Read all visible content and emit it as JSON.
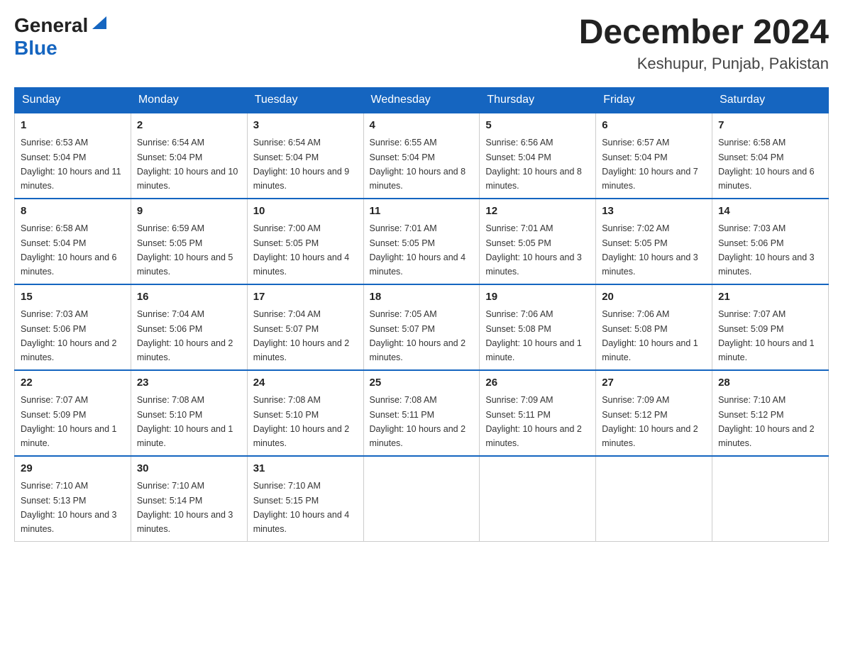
{
  "header": {
    "logo_general": "General",
    "logo_blue": "Blue",
    "month_title": "December 2024",
    "location": "Keshupur, Punjab, Pakistan"
  },
  "weekdays": [
    "Sunday",
    "Monday",
    "Tuesday",
    "Wednesday",
    "Thursday",
    "Friday",
    "Saturday"
  ],
  "weeks": [
    [
      {
        "day": "1",
        "sunrise": "6:53 AM",
        "sunset": "5:04 PM",
        "daylight": "10 hours and 11 minutes."
      },
      {
        "day": "2",
        "sunrise": "6:54 AM",
        "sunset": "5:04 PM",
        "daylight": "10 hours and 10 minutes."
      },
      {
        "day": "3",
        "sunrise": "6:54 AM",
        "sunset": "5:04 PM",
        "daylight": "10 hours and 9 minutes."
      },
      {
        "day": "4",
        "sunrise": "6:55 AM",
        "sunset": "5:04 PM",
        "daylight": "10 hours and 8 minutes."
      },
      {
        "day": "5",
        "sunrise": "6:56 AM",
        "sunset": "5:04 PM",
        "daylight": "10 hours and 8 minutes."
      },
      {
        "day": "6",
        "sunrise": "6:57 AM",
        "sunset": "5:04 PM",
        "daylight": "10 hours and 7 minutes."
      },
      {
        "day": "7",
        "sunrise": "6:58 AM",
        "sunset": "5:04 PM",
        "daylight": "10 hours and 6 minutes."
      }
    ],
    [
      {
        "day": "8",
        "sunrise": "6:58 AM",
        "sunset": "5:04 PM",
        "daylight": "10 hours and 6 minutes."
      },
      {
        "day": "9",
        "sunrise": "6:59 AM",
        "sunset": "5:05 PM",
        "daylight": "10 hours and 5 minutes."
      },
      {
        "day": "10",
        "sunrise": "7:00 AM",
        "sunset": "5:05 PM",
        "daylight": "10 hours and 4 minutes."
      },
      {
        "day": "11",
        "sunrise": "7:01 AM",
        "sunset": "5:05 PM",
        "daylight": "10 hours and 4 minutes."
      },
      {
        "day": "12",
        "sunrise": "7:01 AM",
        "sunset": "5:05 PM",
        "daylight": "10 hours and 3 minutes."
      },
      {
        "day": "13",
        "sunrise": "7:02 AM",
        "sunset": "5:05 PM",
        "daylight": "10 hours and 3 minutes."
      },
      {
        "day": "14",
        "sunrise": "7:03 AM",
        "sunset": "5:06 PM",
        "daylight": "10 hours and 3 minutes."
      }
    ],
    [
      {
        "day": "15",
        "sunrise": "7:03 AM",
        "sunset": "5:06 PM",
        "daylight": "10 hours and 2 minutes."
      },
      {
        "day": "16",
        "sunrise": "7:04 AM",
        "sunset": "5:06 PM",
        "daylight": "10 hours and 2 minutes."
      },
      {
        "day": "17",
        "sunrise": "7:04 AM",
        "sunset": "5:07 PM",
        "daylight": "10 hours and 2 minutes."
      },
      {
        "day": "18",
        "sunrise": "7:05 AM",
        "sunset": "5:07 PM",
        "daylight": "10 hours and 2 minutes."
      },
      {
        "day": "19",
        "sunrise": "7:06 AM",
        "sunset": "5:08 PM",
        "daylight": "10 hours and 1 minute."
      },
      {
        "day": "20",
        "sunrise": "7:06 AM",
        "sunset": "5:08 PM",
        "daylight": "10 hours and 1 minute."
      },
      {
        "day": "21",
        "sunrise": "7:07 AM",
        "sunset": "5:09 PM",
        "daylight": "10 hours and 1 minute."
      }
    ],
    [
      {
        "day": "22",
        "sunrise": "7:07 AM",
        "sunset": "5:09 PM",
        "daylight": "10 hours and 1 minute."
      },
      {
        "day": "23",
        "sunrise": "7:08 AM",
        "sunset": "5:10 PM",
        "daylight": "10 hours and 1 minute."
      },
      {
        "day": "24",
        "sunrise": "7:08 AM",
        "sunset": "5:10 PM",
        "daylight": "10 hours and 2 minutes."
      },
      {
        "day": "25",
        "sunrise": "7:08 AM",
        "sunset": "5:11 PM",
        "daylight": "10 hours and 2 minutes."
      },
      {
        "day": "26",
        "sunrise": "7:09 AM",
        "sunset": "5:11 PM",
        "daylight": "10 hours and 2 minutes."
      },
      {
        "day": "27",
        "sunrise": "7:09 AM",
        "sunset": "5:12 PM",
        "daylight": "10 hours and 2 minutes."
      },
      {
        "day": "28",
        "sunrise": "7:10 AM",
        "sunset": "5:12 PM",
        "daylight": "10 hours and 2 minutes."
      }
    ],
    [
      {
        "day": "29",
        "sunrise": "7:10 AM",
        "sunset": "5:13 PM",
        "daylight": "10 hours and 3 minutes."
      },
      {
        "day": "30",
        "sunrise": "7:10 AM",
        "sunset": "5:14 PM",
        "daylight": "10 hours and 3 minutes."
      },
      {
        "day": "31",
        "sunrise": "7:10 AM",
        "sunset": "5:15 PM",
        "daylight": "10 hours and 4 minutes."
      },
      null,
      null,
      null,
      null
    ]
  ],
  "labels": {
    "sunrise": "Sunrise:",
    "sunset": "Sunset:",
    "daylight": "Daylight:"
  }
}
